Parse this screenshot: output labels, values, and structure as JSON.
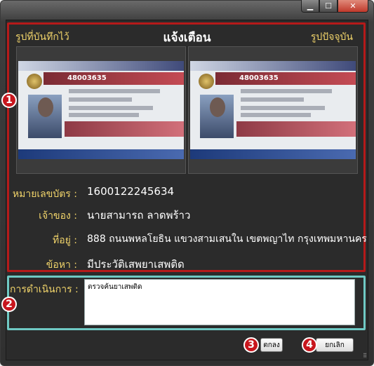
{
  "window": {
    "minimize_icon": "minimize-icon",
    "maximize_icon": "maximize-icon",
    "close_icon": "close-icon"
  },
  "dialog": {
    "title": "แจ้งเตือน",
    "saved_photo_label": "รูปที่บันทึกไว้",
    "current_photo_label": "รูปปัจจุบัน"
  },
  "license": {
    "card_number": "48003635"
  },
  "info": {
    "id_label": "หมายเลขบัตร :",
    "id_value": "1600122245634",
    "owner_label": "เจ้าของ :",
    "owner_value": "นายสามารถ ลาดพร้าว",
    "address_label": "ที่อยู่ :",
    "address_value": "888 ถนนพหลโยธิน แขวงสามเสนใน เขตพญาไท กรุงเทพมหานคร",
    "charge_label": "ข้อหา :",
    "charge_value": "มีประวัติเสพยาเสพติด"
  },
  "action": {
    "label": "การดำเนินการ :",
    "value": "ตรวจค้นยาเสพติด"
  },
  "buttons": {
    "ok_label": "ตกลง",
    "cancel_label": "ยกเลิก"
  },
  "markers": [
    "1",
    "2",
    "3",
    "4"
  ],
  "colors": {
    "accent_label": "#f0d36a",
    "panel_red": "#b51a1a",
    "panel_teal": "#6fc9c4",
    "marker_red": "#c8161d"
  }
}
